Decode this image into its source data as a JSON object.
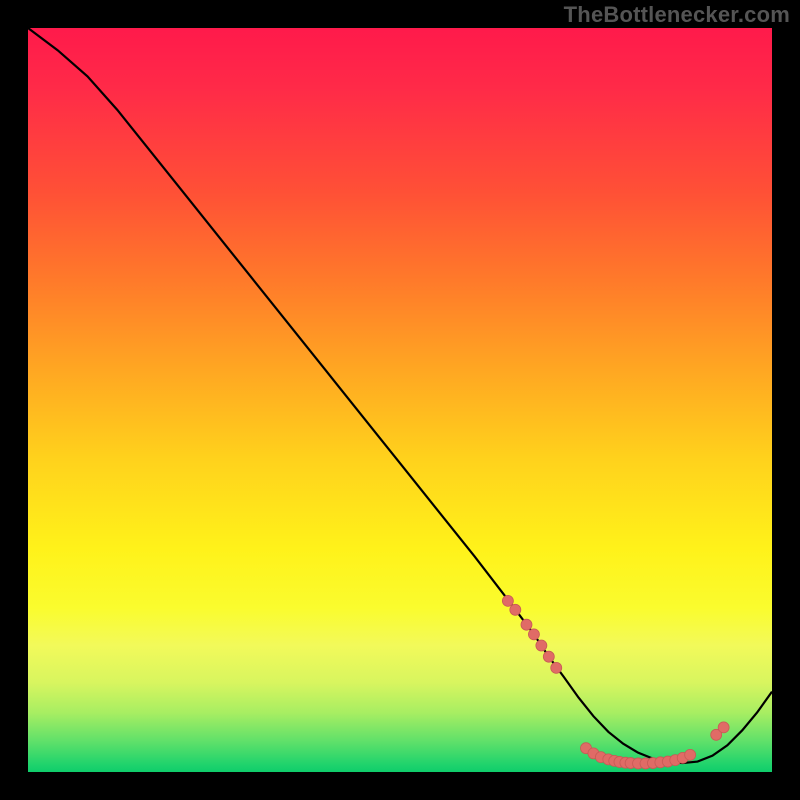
{
  "watermark": "TheBottlenecker.com",
  "colors": {
    "curve_stroke": "#000000",
    "marker_fill": "#e06b66",
    "marker_stroke": "#c85a56"
  },
  "chart_data": {
    "type": "line",
    "title": "",
    "xlabel": "",
    "ylabel": "",
    "xlim": [
      0,
      100
    ],
    "ylim": [
      0,
      100
    ],
    "series": [
      {
        "name": "curve",
        "x": [
          0,
          4,
          8,
          12,
          20,
          30,
          40,
          50,
          60,
          65,
          68,
          70,
          72,
          74,
          76,
          78,
          80,
          82,
          84,
          86,
          88,
          90,
          92,
          94,
          96,
          98,
          100
        ],
        "y": [
          100,
          97,
          93.5,
          89,
          79,
          66.5,
          54,
          41.5,
          29,
          22.5,
          18.5,
          15.5,
          12.8,
          10,
          7.5,
          5.4,
          3.8,
          2.6,
          1.8,
          1.3,
          1.2,
          1.4,
          2.2,
          3.6,
          5.6,
          8.0,
          10.8
        ]
      }
    ],
    "markers": [
      {
        "x": 64.5,
        "y": 23.0
      },
      {
        "x": 65.5,
        "y": 21.8
      },
      {
        "x": 67.0,
        "y": 19.8
      },
      {
        "x": 68.0,
        "y": 18.5
      },
      {
        "x": 69.0,
        "y": 17.0
      },
      {
        "x": 70.0,
        "y": 15.5
      },
      {
        "x": 71.0,
        "y": 14.0
      },
      {
        "x": 75.0,
        "y": 3.2
      },
      {
        "x": 76.0,
        "y": 2.5
      },
      {
        "x": 77.0,
        "y": 2.0
      },
      {
        "x": 78.0,
        "y": 1.7
      },
      {
        "x": 78.8,
        "y": 1.5
      },
      {
        "x": 79.5,
        "y": 1.35
      },
      {
        "x": 80.3,
        "y": 1.25
      },
      {
        "x": 81.0,
        "y": 1.2
      },
      {
        "x": 82.0,
        "y": 1.15
      },
      {
        "x": 83.0,
        "y": 1.15
      },
      {
        "x": 84.0,
        "y": 1.2
      },
      {
        "x": 85.0,
        "y": 1.3
      },
      {
        "x": 86.0,
        "y": 1.4
      },
      {
        "x": 87.0,
        "y": 1.6
      },
      {
        "x": 88.0,
        "y": 1.9
      },
      {
        "x": 89.0,
        "y": 2.3
      },
      {
        "x": 92.5,
        "y": 5.0
      },
      {
        "x": 93.5,
        "y": 6.0
      }
    ]
  }
}
